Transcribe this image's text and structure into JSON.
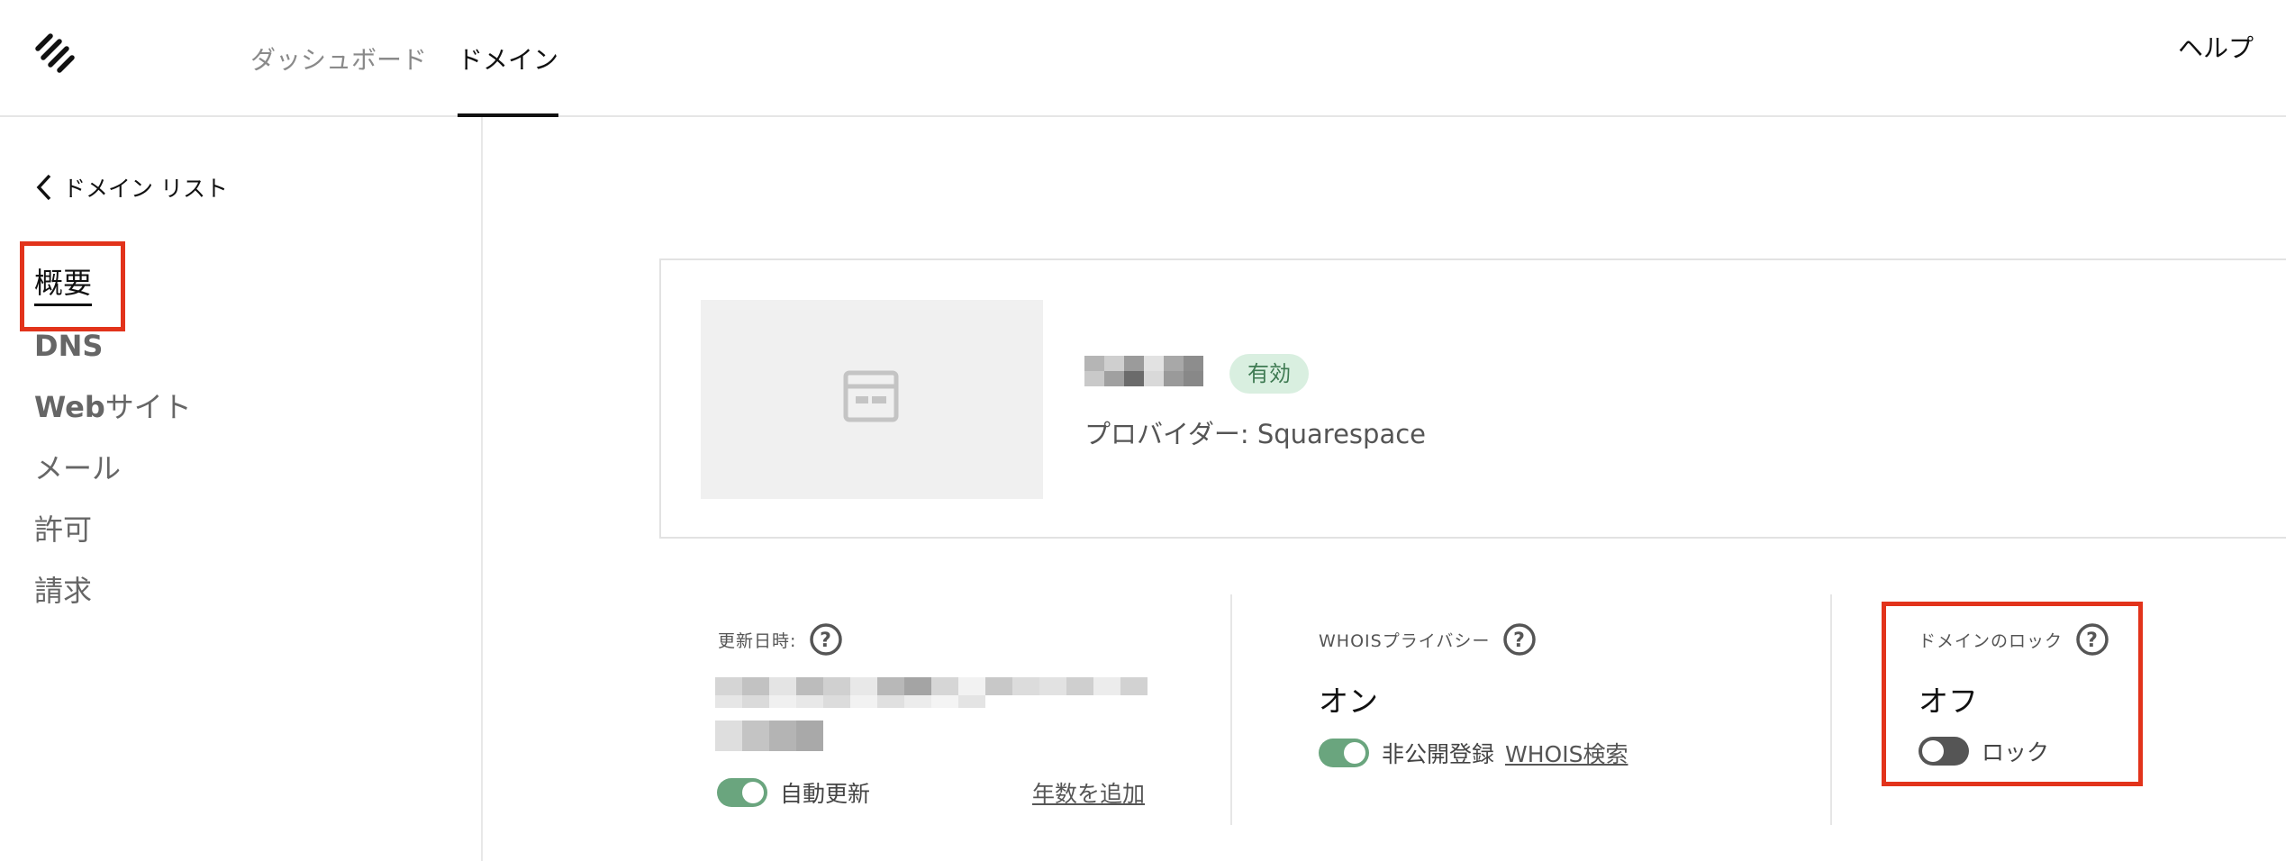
{
  "header": {
    "tabs": [
      {
        "label": "ダッシュボード",
        "active": false
      },
      {
        "label": "ドメイン",
        "active": true
      }
    ],
    "help_label": "ヘルプ"
  },
  "sidebar": {
    "back_label": "ドメイン リスト",
    "items": [
      {
        "label": "概要",
        "active": true
      },
      {
        "label": "DNS",
        "active": false
      },
      {
        "label_bold": "Web",
        "label_rest": "サイト",
        "active": false
      },
      {
        "label": "メール",
        "active": false
      },
      {
        "label": "許可",
        "active": false
      },
      {
        "label": "請求",
        "active": false
      }
    ]
  },
  "domain_card": {
    "status_badge": "有効",
    "provider_text": "プロバイダー: Squarespace",
    "domain_name_redacted": true
  },
  "info": {
    "renewal": {
      "label": "更新日時:",
      "auto_renew_label": "自動更新",
      "auto_renew_on": true,
      "add_years_link": "年数を追加",
      "date_redacted": true
    },
    "whois": {
      "label": "WHOISプライバシー",
      "value": "オン",
      "private_toggle_on": true,
      "private_label": "非公開登録",
      "lookup_link": "WHOIS検索"
    },
    "lock": {
      "label": "ドメインのロック",
      "value": "オフ",
      "lock_toggle_on": false,
      "lock_label": "ロック"
    }
  },
  "colors": {
    "highlight_box": "#e2331b",
    "toggle_on": "#6aa57e",
    "toggle_off": "#555555",
    "badge_bg": "#d9efe0",
    "badge_text": "#3e7a52"
  },
  "icons": {
    "logo": "squarespace-logo",
    "back": "chevron-left-icon",
    "thumbnail": "browser-window-icon",
    "help": "question-circle-icon"
  }
}
